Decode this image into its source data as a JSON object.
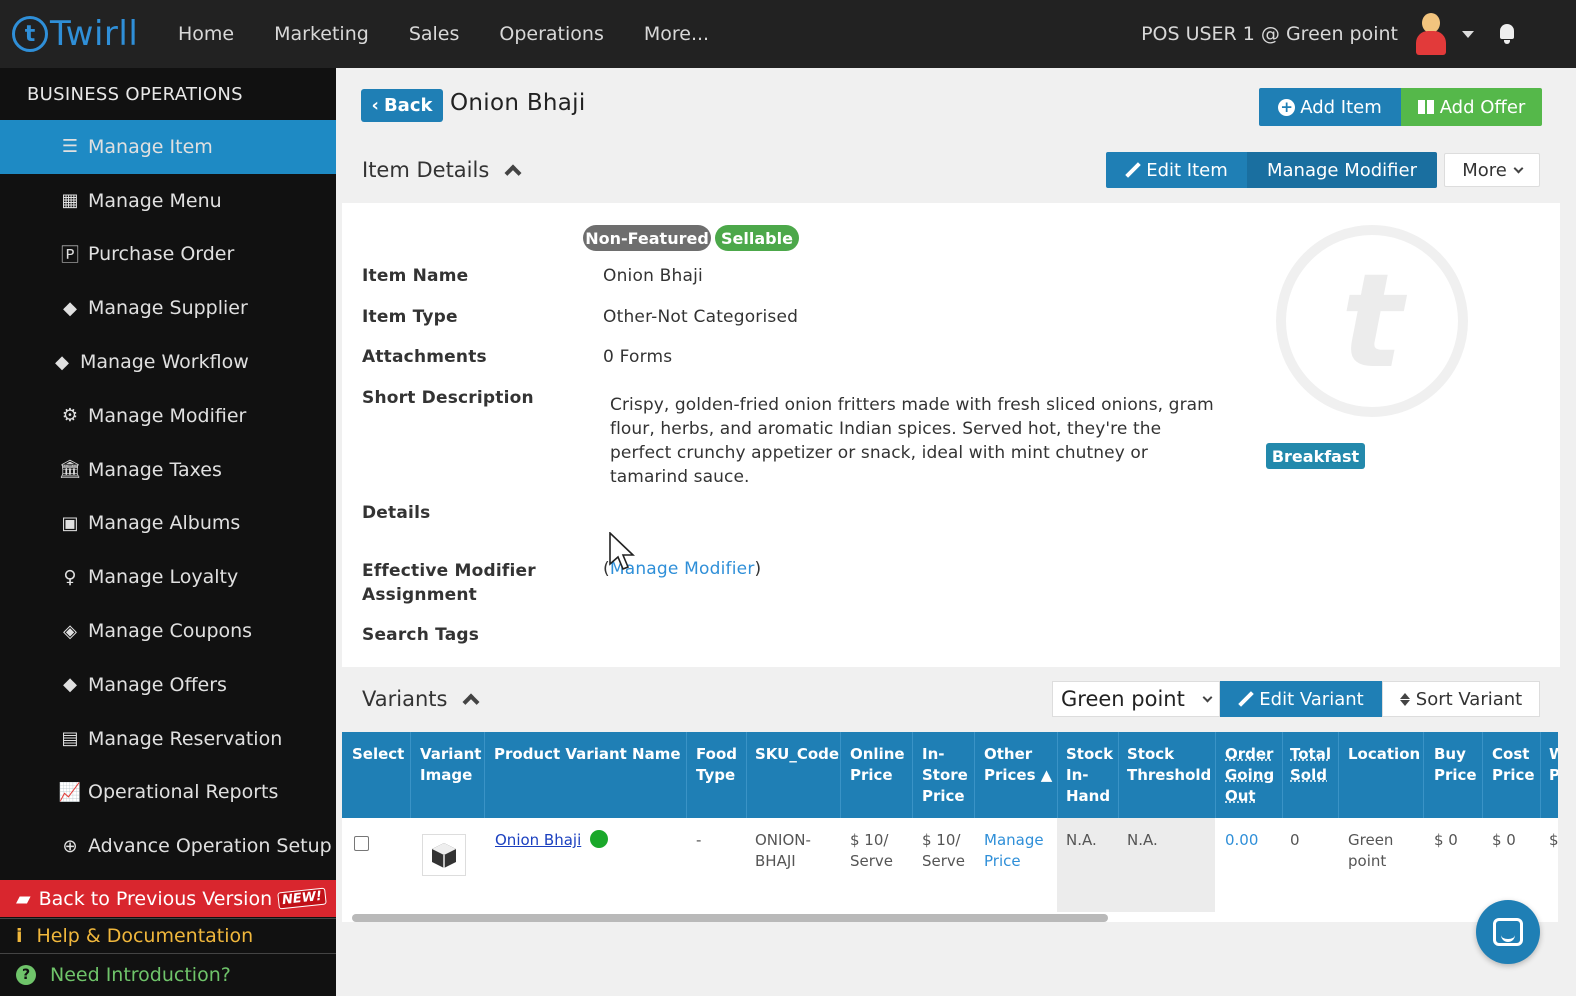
{
  "app": {
    "logo_text": "Twirll",
    "nav": [
      "Home",
      "Marketing",
      "Sales",
      "Operations",
      "More..."
    ],
    "user": "POS USER 1 @ Green point"
  },
  "sidebar": {
    "header": "BUSINESS OPERATIONS",
    "items": [
      {
        "label": "Manage Item",
        "icon": "list-icon"
      },
      {
        "label": "Manage Menu",
        "icon": "table-icon"
      },
      {
        "label": "Purchase Order",
        "icon": "document-p-icon"
      },
      {
        "label": "Manage Supplier",
        "icon": "tags-icon"
      },
      {
        "label": "Manage Workflow",
        "icon": "tags-icon"
      },
      {
        "label": "Manage Modifier",
        "icon": "gears-icon"
      },
      {
        "label": "Manage Taxes",
        "icon": "bank-icon"
      },
      {
        "label": "Manage Albums",
        "icon": "image-icon"
      },
      {
        "label": "Manage Loyalty",
        "icon": "ribbon-icon"
      },
      {
        "label": "Manage Coupons",
        "icon": "ticket-icon"
      },
      {
        "label": "Manage Offers",
        "icon": "tags-icon"
      },
      {
        "label": "Manage Reservation",
        "icon": "contact-book-icon"
      },
      {
        "label": "Operational Reports",
        "icon": "line-chart-icon"
      },
      {
        "label": "Advance Operation Setup",
        "icon": "plus-circle-icon"
      }
    ],
    "back_prev": "Back to Previous Version",
    "new_tag": "NEW!",
    "help": "Help & Documentation",
    "intro": "Need Introduction?"
  },
  "header": {
    "back_label": "Back",
    "title": "Onion Bhaji",
    "add_item": "Add Item",
    "add_offer": "Add Offer"
  },
  "details": {
    "section_title": "Item Details",
    "edit_item": "Edit Item",
    "manage_modifier": "Manage Modifier",
    "more": "More",
    "badges": [
      "Non-Featured",
      "Sellable"
    ],
    "fields": {
      "item_name_label": "Item Name",
      "item_name": "Onion Bhaji",
      "item_type_label": "Item Type",
      "item_type": "Other-Not Categorised",
      "attachments_label": "Attachments",
      "attachments": "0 Forms",
      "short_desc_label": "Short Description",
      "short_desc": "Crispy, golden-fried onion fritters made with fresh sliced onions, gram flour, herbs, and aromatic Indian spices. Served hot, they're the perfect crunchy appetizer or snack, ideal with mint chutney or tamarind sauce.",
      "details_label": "Details",
      "eff_mod_label": "Effective Modifier Assignment",
      "eff_mod_open": "(",
      "eff_mod_link": "Manage Modifier",
      "eff_mod_close": ")",
      "search_tags_label": "Search Tags"
    },
    "category_tag": "Breakfast"
  },
  "variants": {
    "section_title": "Variants",
    "location": "Green point",
    "edit_variant": "Edit Variant",
    "sort_variant": "Sort Variant",
    "columns": [
      "Select",
      "Variant Image",
      "Product Variant Name",
      "Food Type",
      "SKU_Code",
      "Online Price",
      "In-Store Price",
      "Other Prices",
      "Stock In-Hand",
      "Stock Threshold",
      "Order Going Out",
      "Total Sold",
      "Location",
      "Buy Price",
      "Cost Price",
      "W P"
    ],
    "row": {
      "name": "Onion Bhaji",
      "food_type": "-",
      "sku": "ONION-BHAJI",
      "online_price": "$ 10/ Serve",
      "instore_price": "$ 10/ Serve",
      "other_prices": "Manage Price",
      "stock_in_hand": "N.A.",
      "stock_threshold": "N.A.",
      "order_going_out": "0.00",
      "total_sold": "0",
      "location": "Green point",
      "buy_price": "$ 0",
      "cost_price": "$ 0",
      "w_price": "$"
    }
  },
  "colors": {
    "primary": "#1f7fb5",
    "success": "#55b84a",
    "danger": "#d9262e",
    "sidebar_bg": "#111111",
    "topbar_bg": "#222222"
  }
}
